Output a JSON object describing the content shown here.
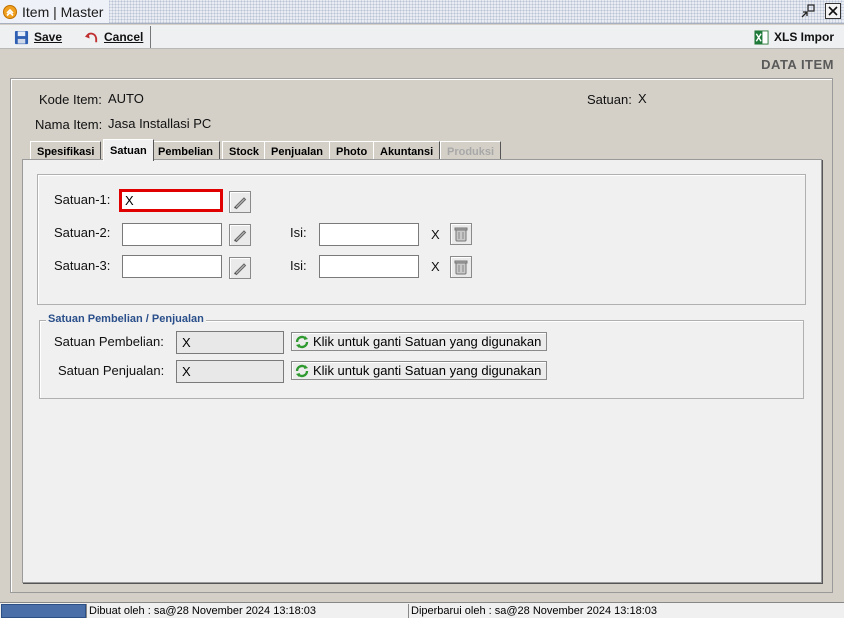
{
  "window": {
    "title": "Item | Master"
  },
  "toolbar": {
    "save_label": "Save",
    "cancel_label": "Cancel",
    "xls_label": "XLS Impor"
  },
  "header": {
    "label": "DATA ITEM"
  },
  "form": {
    "kode_item_label": "Kode Item:",
    "kode_item_value": "AUTO",
    "nama_item_label": "Nama Item:",
    "nama_item_value": "Jasa Installasi PC",
    "satuan_label": "Satuan:",
    "satuan_value": "X"
  },
  "tabs": [
    {
      "label": "Spesifikasi"
    },
    {
      "label": "Satuan"
    },
    {
      "label": "Pembelian"
    },
    {
      "label": "Stock"
    },
    {
      "label": "Penjualan"
    },
    {
      "label": "Photo"
    },
    {
      "label": "Akuntansi"
    },
    {
      "label": "Produksi"
    }
  ],
  "satuan_tab": {
    "satuan1_label": "Satuan-1:",
    "satuan1_value": "X",
    "satuan2_label": "Satuan-2:",
    "satuan2_value": "",
    "satuan3_label": "Satuan-3:",
    "satuan3_value": "",
    "isi_label": "Isi:",
    "isi2_value": "",
    "isi3_value": "",
    "isi_unit": "X",
    "group_title": "Satuan Pembelian / Penjualan",
    "pembelian_label": "Satuan Pembelian:",
    "pembelian_value": "X",
    "penjualan_label": "Satuan Penjualan:",
    "penjualan_value": "X",
    "change_button_label": "Klik untuk ganti Satuan yang digunakan"
  },
  "status": {
    "created": "Dibuat oleh : sa@28 November 2024  13:18:03",
    "updated": "Diperbarui oleh : sa@28 November 2024  13:18:03"
  },
  "icons": {
    "app": "app-chevron-icon",
    "save": "floppy-disk-icon",
    "cancel": "undo-arrow-icon",
    "xls": "excel-icon",
    "edit": "pencil-icon",
    "delete": "trash-icon",
    "refresh": "refresh-icon"
  },
  "colors": {
    "focus_border": "#e00000",
    "group_title": "#2a4f8a",
    "status_block": "#4a6ea8"
  }
}
